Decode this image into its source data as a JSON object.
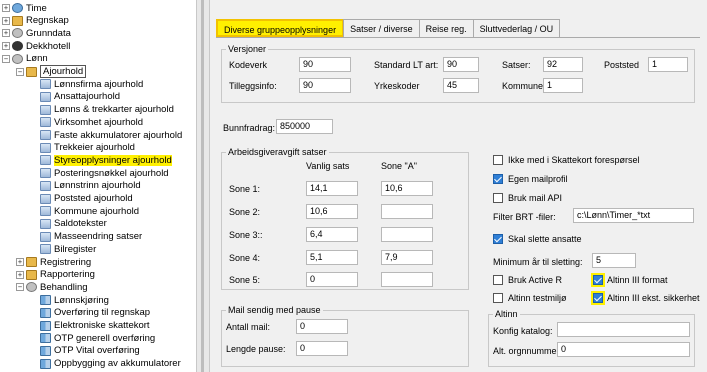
{
  "tree": [
    {
      "label": "Time",
      "icon": "clock-icon",
      "exp": "+"
    },
    {
      "label": "Regnskap",
      "icon": "ledger-icon",
      "exp": "+"
    },
    {
      "label": "Grunndata",
      "icon": "database-icon",
      "exp": "+"
    },
    {
      "label": "Dekkhotell",
      "icon": "tire-icon",
      "exp": "+"
    },
    {
      "label": "Lønn",
      "icon": "person-icon",
      "exp": "−"
    },
    {
      "label": "Ajourhold",
      "icon": "folder-icon",
      "exp": "−"
    },
    {
      "label": "Lønnsfirma ajourhold",
      "icon": "document-icon"
    },
    {
      "label": "Ansattajourhold",
      "icon": "document-icon"
    },
    {
      "label": "Lønns & trekkarter ajourhold",
      "icon": "document-icon"
    },
    {
      "label": "Virksomhet ajourhold",
      "icon": "document-icon"
    },
    {
      "label": "Faste akkumulatorer ajourhold",
      "icon": "document-icon"
    },
    {
      "label": "Trekkeier ajourhold",
      "icon": "document-icon"
    },
    {
      "label": "Styreopplysninger ajourhold",
      "icon": "document-icon"
    },
    {
      "label": "Posteringsnøkkel ajourhold",
      "icon": "document-icon"
    },
    {
      "label": "Lønnstrinn ajourhold",
      "icon": "document-icon"
    },
    {
      "label": "Poststed ajourhold",
      "icon": "document-icon"
    },
    {
      "label": "Kommune ajourhold",
      "icon": "document-icon"
    },
    {
      "label": "Saldotekster",
      "icon": "document-icon"
    },
    {
      "label": "Masseendring satser",
      "icon": "document-icon"
    },
    {
      "label": "Bilregister",
      "icon": "document-icon"
    },
    {
      "label": "Registrering",
      "icon": "folder-icon",
      "exp": "+"
    },
    {
      "label": "Rapportering",
      "icon": "report-icon",
      "exp": "+"
    },
    {
      "label": "Behandling",
      "icon": "gear-icon",
      "exp": "−"
    },
    {
      "label": "Lønnskjøring",
      "icon": "grid-icon"
    },
    {
      "label": "Overføring til regnskap",
      "icon": "grid-icon"
    },
    {
      "label": "Elektroniske skattekort",
      "icon": "grid-icon"
    },
    {
      "label": "OTP generell overføring",
      "icon": "grid-icon"
    },
    {
      "label": "OTP Vital overføring",
      "icon": "grid-icon"
    },
    {
      "label": "Oppbygging av akkumulatorer",
      "icon": "grid-icon"
    }
  ],
  "tabs": [
    "Diverse gruppeopplysninger",
    "Satser / diverse",
    "Reise reg.",
    "Sluttvederlag / OU"
  ],
  "versjoner": {
    "title": "Versjoner",
    "kodeverk_label": "Kodeverk",
    "kodeverk": "90",
    "tilleggsinfo_label": "Tilleggsinfo:",
    "tilleggsinfo": "90",
    "standard_label": "Standard LT art:",
    "standard": "90",
    "yrkeskoder_label": "Yrkeskoder",
    "yrkeskoder": "45",
    "satser_label": "Satser:",
    "satser": "92",
    "kommune_label": "Kommune",
    "kommune": "1",
    "poststed_label": "Poststed",
    "poststed": "1"
  },
  "bunnfradrag": {
    "label": "Bunnfradrag:",
    "value": "850000"
  },
  "aga": {
    "title": "Arbeidsgiveravgift satser",
    "col1": "Vanlig sats",
    "col2": "Sone \"A\"",
    "rows": [
      {
        "label": "Sone 1:",
        "v1": "14,1",
        "v2": "10,6"
      },
      {
        "label": "Sone 2:",
        "v1": "10,6",
        "v2": ""
      },
      {
        "label": "Sone 3::",
        "v1": "6,4",
        "v2": ""
      },
      {
        "label": "Sone 4:",
        "v1": "5,1",
        "v2": "7,9"
      },
      {
        "label": "Sone 5:",
        "v1": "0",
        "v2": ""
      }
    ]
  },
  "right": {
    "ikke_med": "Ikke med i Skattekort forespørsel",
    "egen_mailprofil": "Egen mailprofil",
    "bruk_mail_api": "Bruk mail API",
    "filter_label": "Filter BRT -filer:",
    "filter_value": "c:\\Lønn\\Timer_*txt",
    "skal_slette": "Skal slette ansatte",
    "minimum_label": "Minimum år til sletting:",
    "minimum_value": "5",
    "bruk_active_r": "Bruk Active R",
    "altinn_testmiljo": "Altinn testmiljø",
    "altinn3_format": "Altinn III format",
    "altinn3_sikkerhet": "Altinn III ekst. sikkerhet"
  },
  "mail": {
    "title": "Mail sendig med pause",
    "antall_label": "Antall mail:",
    "antall": "0",
    "lengde_label": "Lengde pause:",
    "lengde": "0"
  },
  "altinn": {
    "title": "Altinn",
    "konfig_label": "Konfig katalog:",
    "konfig": "",
    "orgnr_label": "Alt. orgnnummer",
    "orgnr": "0"
  },
  "colors": {
    "highlight": "#fff000",
    "checkbox": "#2f7fd6"
  }
}
